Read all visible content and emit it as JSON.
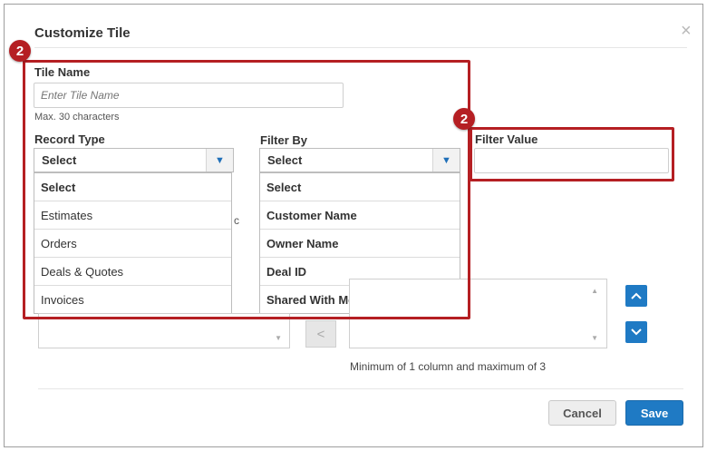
{
  "dialog": {
    "title": "Customize Tile",
    "close_icon": "close-icon"
  },
  "tile_name": {
    "label": "Tile Name",
    "placeholder": "Enter Tile Name",
    "hint": "Max. 30 characters"
  },
  "record_type": {
    "label": "Record Type",
    "selected": "Select",
    "options": [
      "Select",
      "Estimates",
      "Orders",
      "Deals & Quotes",
      "Invoices"
    ]
  },
  "filter_by": {
    "label": "Filter By",
    "selected": "Select",
    "options": [
      "Select",
      "Customer Name",
      "Owner Name",
      "Deal ID",
      "Shared With Me"
    ]
  },
  "filter_value": {
    "label": "Filter Value",
    "value": ""
  },
  "partial_text": {
    "c_fragment": "c"
  },
  "columns": {
    "move_left_label": "<",
    "hint": "Minimum of 1 column and maximum of 3",
    "up_icon": "chevron-up-icon",
    "down_icon": "chevron-down-icon"
  },
  "annotations": {
    "badge_1": "2",
    "badge_2": "2",
    "highlight_color": "#b51f23"
  },
  "footer": {
    "cancel_label": "Cancel",
    "save_label": "Save"
  },
  "colors": {
    "primary": "#1f7ac4",
    "annotation_red": "#b51f23"
  }
}
